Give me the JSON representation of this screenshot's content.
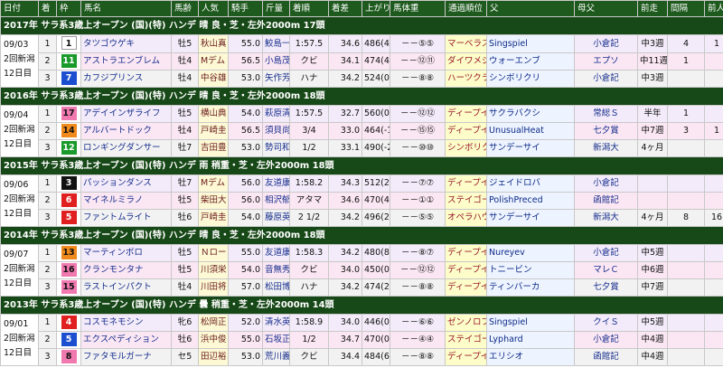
{
  "headers": [
    "日付",
    "着",
    "枠",
    "馬名",
    "馬齢",
    "人気",
    "騎手",
    "斤量",
    "着順",
    "着差",
    "上がり",
    "馬体重",
    "通過順位",
    "父",
    "母父",
    "前走",
    "間隔",
    "前人",
    "前着"
  ],
  "frame_colors": {
    "1": [
      "#ffffff",
      "#111111"
    ],
    "2": [
      "#111111",
      "#ffffff"
    ],
    "3": [
      "#e02020",
      "#ffffff"
    ],
    "4": [
      "#1c4fd0",
      "#ffffff"
    ],
    "5": [
      "#f4d800",
      "#111111"
    ],
    "6": [
      "#1a9a2a",
      "#ffffff"
    ],
    "7": [
      "#f08a1c",
      "#111111"
    ],
    "8": [
      "#f07ab0",
      "#111111"
    ]
  },
  "races": [
    {
      "title": "2017年 サラ系3歳上オープン (国)(特) ハンデ 晴 良・芝・左外2000m 17頭",
      "date": [
        "09/03",
        "2回新潟",
        "12日目"
      ],
      "rows": [
        {
          "rank": "1",
          "waku": 1,
          "umaban": "1",
          "name": "タツゴウゲキ",
          "age": "牡5",
          "jockey": "秋山真",
          "kinryo": "55.0",
          "time": "鮫島一",
          "margin": "1:57.5",
          "agari": "34.6",
          "weight": "486(4)",
          "pass": "－－⑤⑤",
          "sire": "マーベラスサンデー",
          "damsire": "Singspiel",
          "prev": "小倉記",
          "interval": "中3週",
          "prevpop": "4",
          "prevrank": "1"
        },
        {
          "rank": "2",
          "waku": 6,
          "umaban": "11",
          "name": "アストラエンブレム",
          "age": "牡4",
          "jockey": "Mデム",
          "kinryo": "56.5",
          "time": "小島茂",
          "margin": "クビ",
          "agari": "34.1",
          "weight": "474(4)",
          "pass": "－－⑫⑪",
          "sire": "ダイワメジャー",
          "damsire": "ウォーエンブ",
          "prev": "エプソ",
          "interval": "中11週",
          "prevpop": "1",
          "prevrank": ""
        },
        {
          "rank": "3",
          "waku": 4,
          "umaban": "7",
          "name": "カフジプリンス",
          "age": "牡4",
          "jockey": "中谷雄",
          "kinryo": "53.0",
          "time": "矢作芳",
          "margin": "ハナ",
          "agari": "34.2",
          "weight": "524(0)",
          "pass": "－－⑧⑧",
          "sire": "ハーツクライ",
          "damsire": "シンボリクリ",
          "prev": "小倉記",
          "interval": "中3週",
          "prevpop": "",
          "prevrank": ""
        }
      ]
    },
    {
      "title": "2016年 サラ系3歳上オープン (国)(特) ハンデ 晴 良・芝・左外2000m 18頭",
      "date": [
        "09/04",
        "2回新潟",
        "12日目"
      ],
      "rows": [
        {
          "rank": "1",
          "waku": 8,
          "umaban": "17",
          "name": "アデイインザライフ",
          "age": "牡5",
          "jockey": "横山典",
          "kinryo": "54.0",
          "time": "萩原清",
          "margin": "1:57.5",
          "agari": "32.7",
          "weight": "560(0)",
          "pass": "－－⑫⑫",
          "sire": "ディープインパクト",
          "damsire": "サクラバクシ",
          "prev": "常総Ｓ",
          "interval": "半年",
          "prevpop": "1",
          "prevrank": ""
        },
        {
          "rank": "2",
          "waku": 7,
          "umaban": "14",
          "name": "アルバートドック",
          "age": "牡4",
          "jockey": "戸崎圭",
          "kinryo": "56.5",
          "time": "須貝尚",
          "margin": "3/4",
          "agari": "33.0",
          "weight": "464(-10)",
          "pass": "－－⑮⑮",
          "sire": "ディープインパクト",
          "damsire": "UnusualHeat",
          "prev": "七夕賞",
          "interval": "中7週",
          "prevpop": "3",
          "prevrank": "1"
        },
        {
          "rank": "3",
          "waku": 6,
          "umaban": "12",
          "name": "ロンギングダンサー",
          "age": "牡7",
          "jockey": "吉田豊",
          "kinryo": "53.0",
          "time": "勢司和",
          "margin": "1/2",
          "agari": "33.1",
          "weight": "490(-2)",
          "pass": "－－⑩⑩",
          "sire": "シンボリクリスエス",
          "damsire": "サンデーサイ",
          "prev": "新潟大",
          "interval": "4ヶ月",
          "prevpop": "",
          "prevrank": ""
        }
      ]
    },
    {
      "title": "2015年 サラ系3歳上オープン (国)(特) ハンデ 雨 稍重・芝・左外2000m 18頭",
      "date": [
        "09/06",
        "2回新潟",
        "12日目"
      ],
      "rows": [
        {
          "rank": "1",
          "waku": 2,
          "umaban": "3",
          "name": "パッションダンス",
          "age": "牡7",
          "jockey": "Mデム",
          "kinryo": "56.0",
          "time": "友道康",
          "margin": "1:58.2",
          "agari": "34.3",
          "weight": "512(2)",
          "pass": "－－⑦⑦",
          "sire": "ディープインパクト",
          "damsire": "ジェイドロバ",
          "prev": "小倉記",
          "interval": "",
          "prevpop": "",
          "prevrank": ""
        },
        {
          "rank": "2",
          "waku": 3,
          "umaban": "6",
          "name": "マイネルミラノ",
          "age": "牡5",
          "jockey": "柴田大",
          "kinryo": "56.0",
          "time": "相沢郁",
          "margin": "アタマ",
          "agari": "34.6",
          "weight": "470(4)",
          "pass": "－－①①",
          "sire": "ステイゴールド",
          "damsire": "PolishPreced",
          "prev": "函館記",
          "interval": "",
          "prevpop": "",
          "prevrank": ""
        },
        {
          "rank": "3",
          "waku": 3,
          "umaban": "5",
          "name": "ファントムライト",
          "age": "牡6",
          "jockey": "戸崎圭",
          "kinryo": "54.0",
          "time": "藤原英",
          "margin": "2 1/2",
          "agari": "34.2",
          "weight": "496(2)",
          "pass": "－－⑤⑤",
          "sire": "オペラハウス",
          "damsire": "サンデーサイ",
          "prev": "新潟大",
          "interval": "4ヶ月",
          "prevpop": "8",
          "prevrank": "16"
        }
      ]
    },
    {
      "title": "2014年 サラ系3歳上オープン (国)(特) ハンデ 晴 良・芝・左外2000m 18頭",
      "date": [
        "09/07",
        "2回新潟",
        "12日目"
      ],
      "rows": [
        {
          "rank": "1",
          "waku": 7,
          "umaban": "13",
          "name": "マーティンボロ",
          "age": "牡5",
          "jockey": "Ｎロー",
          "kinryo": "55.0",
          "time": "友道康",
          "margin": "1:58.3",
          "agari": "34.2",
          "weight": "480(8)",
          "pass": "－－⑧⑦",
          "sire": "ディープインパクト",
          "damsire": "Nureyev",
          "prev": "小倉記",
          "interval": "中5週",
          "prevpop": "",
          "prevrank": ""
        },
        {
          "rank": "2",
          "waku": 8,
          "umaban": "16",
          "name": "クランモンタナ",
          "age": "牡5",
          "jockey": "川須栄",
          "kinryo": "54.0",
          "time": "音無秀",
          "margin": "クビ",
          "agari": "34.0",
          "weight": "450(0)",
          "pass": "－－⑫⑫",
          "sire": "ディープインパクト",
          "damsire": "トニービン",
          "prev": "マレＣ",
          "interval": "中6週",
          "prevpop": "",
          "prevrank": ""
        },
        {
          "rank": "3",
          "waku": 8,
          "umaban": "15",
          "name": "ラストインパクト",
          "age": "牡4",
          "jockey": "川田将",
          "kinryo": "57.0",
          "time": "松田博",
          "margin": "ハナ",
          "agari": "34.2",
          "weight": "474(2)",
          "pass": "－－⑧⑧",
          "sire": "ディープインパクト",
          "damsire": "ティンバーカ",
          "prev": "七夕賞",
          "interval": "中7週",
          "prevpop": "",
          "prevrank": ""
        }
      ]
    },
    {
      "title": "2013年 サラ系3歳上オープン (国)(特) ハンデ 曇 稍重・芝・左外2000m 14頭",
      "date": [
        "09/01",
        "2回新潟",
        "12日目"
      ],
      "rows": [
        {
          "rank": "1",
          "waku": 3,
          "umaban": "4",
          "name": "コスモネモシン",
          "age": "牝6",
          "jockey": "松岡正",
          "kinryo": "52.0",
          "time": "清水英",
          "margin": "1:58.9",
          "agari": "34.0",
          "weight": "446(0)",
          "pass": "－－⑥⑥",
          "sire": "ゼンノロブロイ",
          "damsire": "Singspiel",
          "prev": "クイＳ",
          "interval": "中5週",
          "prevpop": "",
          "prevrank": ""
        },
        {
          "rank": "2",
          "waku": 4,
          "umaban": "5",
          "name": "エクスペディション",
          "age": "牡6",
          "jockey": "浜中俊",
          "kinryo": "55.0",
          "time": "石坂正",
          "margin": "1/2",
          "agari": "34.7",
          "weight": "470(0)",
          "pass": "－－④④",
          "sire": "ステイゴールド",
          "damsire": "Lyphard",
          "prev": "小倉記",
          "interval": "中4週",
          "prevpop": "",
          "prevrank": ""
        },
        {
          "rank": "3",
          "waku": 8,
          "umaban": "8",
          "name": "ファタモルガーナ",
          "age": "セ5",
          "jockey": "田辺裕",
          "kinryo": "53.0",
          "time": "荒川義",
          "margin": "クビ",
          "agari": "34.4",
          "weight": "484(6)",
          "pass": "－－⑧⑧",
          "sire": "ディープインパクト",
          "damsire": "エリシオ",
          "prev": "函館記",
          "interval": "中4週",
          "prevpop": "",
          "prevrank": ""
        }
      ]
    }
  ]
}
